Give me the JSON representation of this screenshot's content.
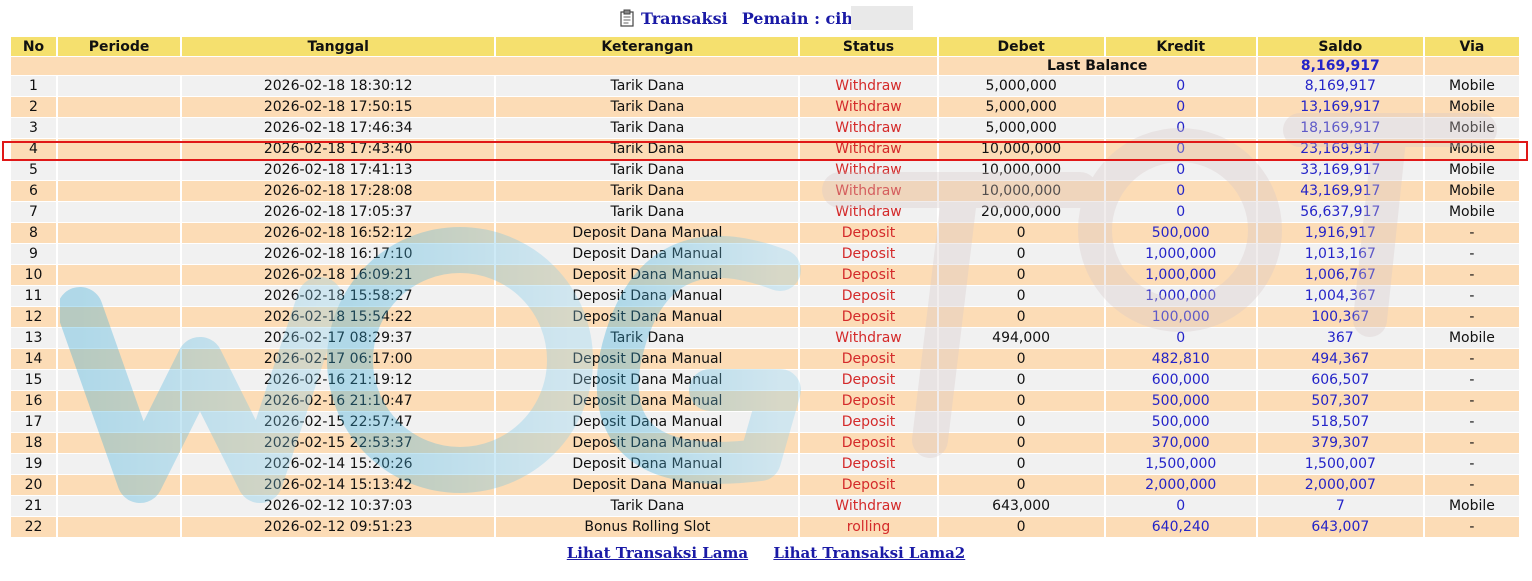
{
  "header": {
    "title": "Transaksi",
    "player_label": "Pemain : cih",
    "icon": "clipboard-icon"
  },
  "table": {
    "columns": [
      "No",
      "Periode",
      "Tanggal",
      "Keterangan",
      "Status",
      "Debet",
      "Kredit",
      "Saldo",
      "Via"
    ],
    "last_balance_label": "Last Balance",
    "last_balance_value": "8,169,917",
    "rows": [
      {
        "no": "1",
        "periode": "",
        "tanggal": "2026-02-18 18:30:12",
        "keterangan": "Tarik Dana",
        "status": "Withdraw",
        "debet": "5,000,000",
        "kredit": "0",
        "saldo": "8,169,917",
        "via": "Mobile"
      },
      {
        "no": "2",
        "periode": "",
        "tanggal": "2026-02-18 17:50:15",
        "keterangan": "Tarik Dana",
        "status": "Withdraw",
        "debet": "5,000,000",
        "kredit": "0",
        "saldo": "13,169,917",
        "via": "Mobile"
      },
      {
        "no": "3",
        "periode": "",
        "tanggal": "2026-02-18 17:46:34",
        "keterangan": "Tarik Dana",
        "status": "Withdraw",
        "debet": "5,000,000",
        "kredit": "0",
        "saldo": "18,169,917",
        "via": "Mobile"
      },
      {
        "no": "4",
        "periode": "",
        "tanggal": "2026-02-18 17:43:40",
        "keterangan": "Tarik Dana",
        "status": "Withdraw",
        "debet": "10,000,000",
        "kredit": "0",
        "saldo": "23,169,917",
        "via": "Mobile"
      },
      {
        "no": "5",
        "periode": "",
        "tanggal": "2026-02-18 17:41:13",
        "keterangan": "Tarik Dana",
        "status": "Withdraw",
        "debet": "10,000,000",
        "kredit": "0",
        "saldo": "33,169,917",
        "via": "Mobile"
      },
      {
        "no": "6",
        "periode": "",
        "tanggal": "2026-02-18 17:28:08",
        "keterangan": "Tarik Dana",
        "status": "Withdraw",
        "debet": "10,000,000",
        "kredit": "0",
        "saldo": "43,169,917",
        "via": "Mobile"
      },
      {
        "no": "7",
        "periode": "",
        "tanggal": "2026-02-18 17:05:37",
        "keterangan": "Tarik Dana",
        "status": "Withdraw",
        "debet": "20,000,000",
        "kredit": "0",
        "saldo": "56,637,917",
        "via": "Mobile"
      },
      {
        "no": "8",
        "periode": "",
        "tanggal": "2026-02-18 16:52:12",
        "keterangan": "Deposit Dana Manual",
        "status": "Deposit",
        "debet": "0",
        "kredit": "500,000",
        "saldo": "1,916,917",
        "via": "-"
      },
      {
        "no": "9",
        "periode": "",
        "tanggal": "2026-02-18 16:17:10",
        "keterangan": "Deposit Dana Manual",
        "status": "Deposit",
        "debet": "0",
        "kredit": "1,000,000",
        "saldo": "1,013,167",
        "via": "-"
      },
      {
        "no": "10",
        "periode": "",
        "tanggal": "2026-02-18 16:09:21",
        "keterangan": "Deposit Dana Manual",
        "status": "Deposit",
        "debet": "0",
        "kredit": "1,000,000",
        "saldo": "1,006,767",
        "via": "-"
      },
      {
        "no": "11",
        "periode": "",
        "tanggal": "2026-02-18 15:58:27",
        "keterangan": "Deposit Dana Manual",
        "status": "Deposit",
        "debet": "0",
        "kredit": "1,000,000",
        "saldo": "1,004,367",
        "via": "-"
      },
      {
        "no": "12",
        "periode": "",
        "tanggal": "2026-02-18 15:54:22",
        "keterangan": "Deposit Dana Manual",
        "status": "Deposit",
        "debet": "0",
        "kredit": "100,000",
        "saldo": "100,367",
        "via": "-"
      },
      {
        "no": "13",
        "periode": "",
        "tanggal": "2026-02-17 08:29:37",
        "keterangan": "Tarik Dana",
        "status": "Withdraw",
        "debet": "494,000",
        "kredit": "0",
        "saldo": "367",
        "via": "Mobile"
      },
      {
        "no": "14",
        "periode": "",
        "tanggal": "2026-02-17 06:17:00",
        "keterangan": "Deposit Dana Manual",
        "status": "Deposit",
        "debet": "0",
        "kredit": "482,810",
        "saldo": "494,367",
        "via": "-"
      },
      {
        "no": "15",
        "periode": "",
        "tanggal": "2026-02-16 21:19:12",
        "keterangan": "Deposit Dana Manual",
        "status": "Deposit",
        "debet": "0",
        "kredit": "600,000",
        "saldo": "606,507",
        "via": "-"
      },
      {
        "no": "16",
        "periode": "",
        "tanggal": "2026-02-16 21:10:47",
        "keterangan": "Deposit Dana Manual",
        "status": "Deposit",
        "debet": "0",
        "kredit": "500,000",
        "saldo": "507,307",
        "via": "-"
      },
      {
        "no": "17",
        "periode": "",
        "tanggal": "2026-02-15 22:57:47",
        "keterangan": "Deposit Dana Manual",
        "status": "Deposit",
        "debet": "0",
        "kredit": "500,000",
        "saldo": "518,507",
        "via": "-"
      },
      {
        "no": "18",
        "periode": "",
        "tanggal": "2026-02-15 22:53:37",
        "keterangan": "Deposit Dana Manual",
        "status": "Deposit",
        "debet": "0",
        "kredit": "370,000",
        "saldo": "379,307",
        "via": "-"
      },
      {
        "no": "19",
        "periode": "",
        "tanggal": "2026-02-14 15:20:26",
        "keterangan": "Deposit Dana Manual",
        "status": "Deposit",
        "debet": "0",
        "kredit": "1,500,000",
        "saldo": "1,500,007",
        "via": "-"
      },
      {
        "no": "20",
        "periode": "",
        "tanggal": "2026-02-14 15:13:42",
        "keterangan": "Deposit Dana Manual",
        "status": "Deposit",
        "debet": "0",
        "kredit": "2,000,000",
        "saldo": "2,000,007",
        "via": "-"
      },
      {
        "no": "21",
        "periode": "",
        "tanggal": "2026-02-12 10:37:03",
        "keterangan": "Tarik Dana",
        "status": "Withdraw",
        "debet": "643,000",
        "kredit": "0",
        "saldo": "7",
        "via": "Mobile"
      },
      {
        "no": "22",
        "periode": "",
        "tanggal": "2026-02-12 09:51:23",
        "keterangan": "Bonus Rolling Slot",
        "status": "rolling",
        "debet": "0",
        "kredit": "640,240",
        "saldo": "643,007",
        "via": "-"
      }
    ]
  },
  "footer": {
    "link1": "Lihat Transaksi Lama",
    "link2": "Lihat Transaksi Lama2"
  },
  "colors": {
    "header_bg": "#f5e06e",
    "row_odd": "#f1f1f1",
    "row_even": "#fcdcb6",
    "status_red": "#d42a2a",
    "value_blue": "#2424c8",
    "highlight": "#e01818"
  }
}
